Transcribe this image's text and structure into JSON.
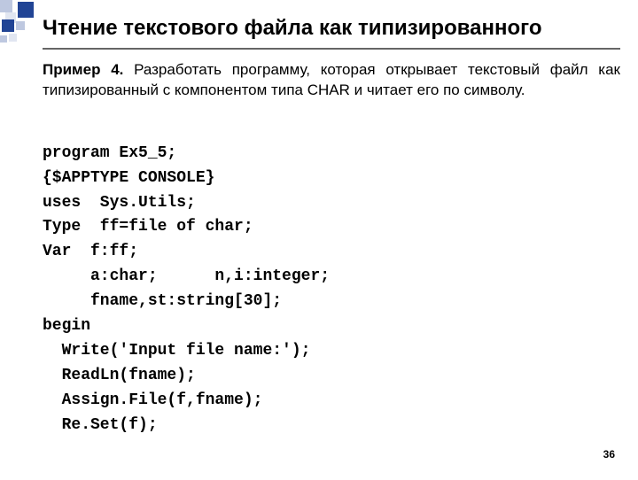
{
  "title": "Чтение текстового файла как типизированного",
  "task": {
    "lead": "Пример 4.",
    "body": " Разработать программу, которая открывает текстовый файл как типизированный с компонентом типа CHAR и читает его по символу."
  },
  "code_lines": [
    "program Ex5_5;",
    "{$APPTYPE CONSOLE}",
    "uses  Sys.Utils;",
    "Type  ff=file of char;",
    "Var  f:ff;",
    "     a:char;      n,i:integer;",
    "     fname,st:string[30];",
    "begin",
    "  Write('Input file name:');",
    "  ReadLn(fname);",
    "  Assign.File(f,fname);",
    "  Re.Set(f);"
  ],
  "page_number": "36"
}
